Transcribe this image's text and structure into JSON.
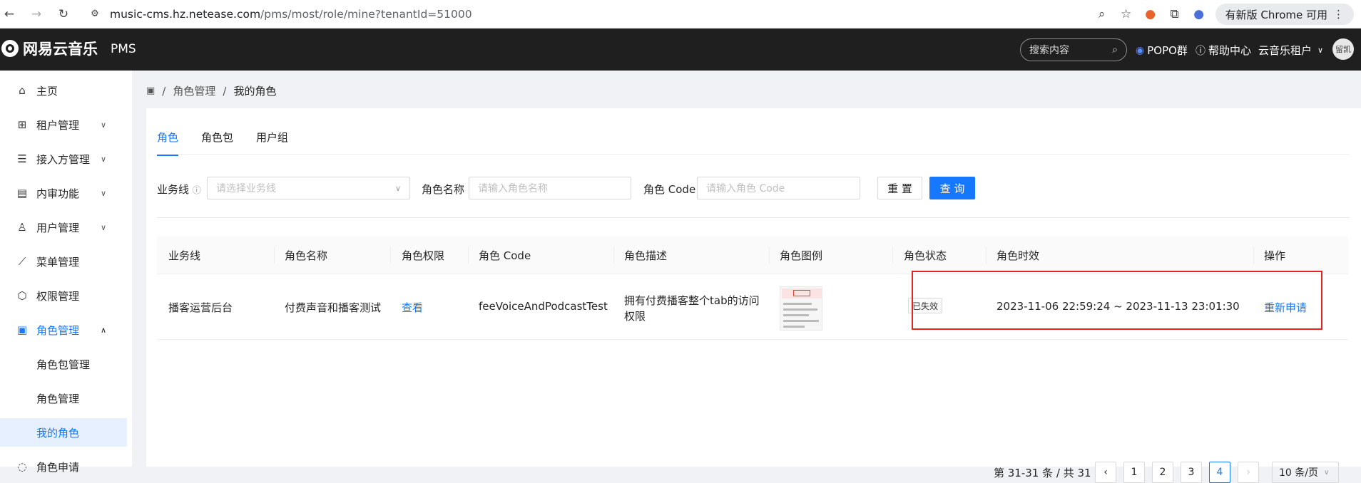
{
  "browser": {
    "url_host": "music-cms.hz.netease.com",
    "url_path": "/pms/most/role/mine?tenantId=51000",
    "update_label": "有新版 Chrome 可用"
  },
  "header": {
    "brand": "网易云音乐",
    "product": "PMS",
    "search_placeholder": "搜索内容",
    "popo": "POPO群",
    "help": "帮助中心",
    "tenant": "云音乐租户",
    "avatar_text": "留凯"
  },
  "sidebar": {
    "items": [
      {
        "label": "主页"
      },
      {
        "label": "租户管理"
      },
      {
        "label": "接入方管理"
      },
      {
        "label": "内审功能"
      },
      {
        "label": "用户管理"
      },
      {
        "label": "菜单管理"
      },
      {
        "label": "权限管理"
      },
      {
        "label": "角色管理"
      },
      {
        "label": "角色包管理"
      },
      {
        "label": "角色管理"
      },
      {
        "label": "我的角色"
      },
      {
        "label": "角色申请"
      }
    ]
  },
  "breadcrumb": {
    "sep": "/",
    "level1": "角色管理",
    "level2": "我的角色"
  },
  "tabs": [
    {
      "label": "角色"
    },
    {
      "label": "角色包"
    },
    {
      "label": "用户组"
    }
  ],
  "filters": {
    "biz_label": "业务线",
    "biz_placeholder": "请选择业务线",
    "name_label": "角色名称",
    "name_placeholder": "请输入角色名称",
    "code_label": "角色 Code",
    "code_placeholder": "请输入角色 Code",
    "reset": "重 置",
    "query": "查 询"
  },
  "table": {
    "columns": [
      "业务线",
      "角色名称",
      "角色权限",
      "角色 Code",
      "角色描述",
      "角色图例",
      "角色状态",
      "角色时效",
      "操作"
    ],
    "rows": [
      {
        "biz": "播客运营后台",
        "name": "付费声音和播客测试",
        "perm": "查看",
        "code": "feeVoiceAndPodcastTest",
        "desc_line1": "拥有付费播客整个tab的访问",
        "desc_line2": "权限",
        "status": "已失效",
        "validity": "2023-11-06 22:59:24 ~ 2023-11-13 23:01:30",
        "action": "重新申请"
      }
    ]
  },
  "pagination": {
    "summary": "第 31-31 条 / 共 31 条",
    "pages": [
      "1",
      "2",
      "3",
      "4"
    ],
    "current": 4,
    "page_size": "10 条/页"
  }
}
